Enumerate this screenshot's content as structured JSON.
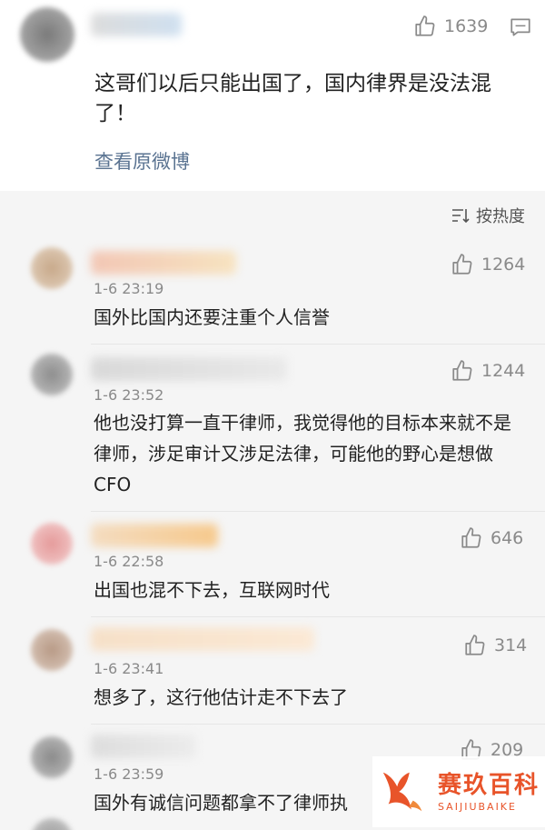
{
  "top_post": {
    "like_count": "1639",
    "text": "这哥们以后只能出国了，国内律界是没法混了！",
    "view_original_label": "查看原微博"
  },
  "sort": {
    "label": "按热度"
  },
  "comments": [
    {
      "time": "1-6 23:19",
      "likes": "1264",
      "text": "国外比国内还要注重个人信誉"
    },
    {
      "time": "1-6 23:52",
      "likes": "1244",
      "text": "他也没打算一直干律师，我觉得他的目标本来就不是律师，涉足审计又涉足法律，可能他的野心是想做CFO"
    },
    {
      "time": "1-6 22:58",
      "likes": "646",
      "text": "出国也混不下去，互联网时代"
    },
    {
      "time": "1-6 23:41",
      "likes": "314",
      "text": "想多了，这行他估计走不下去了"
    },
    {
      "time": "1-6 23:59",
      "likes": "209",
      "text": "国外有诚信问题都拿不了律师执"
    }
  ],
  "watermark": {
    "cn": "赛玖百科",
    "en": "SAIJIUBAIKE"
  }
}
